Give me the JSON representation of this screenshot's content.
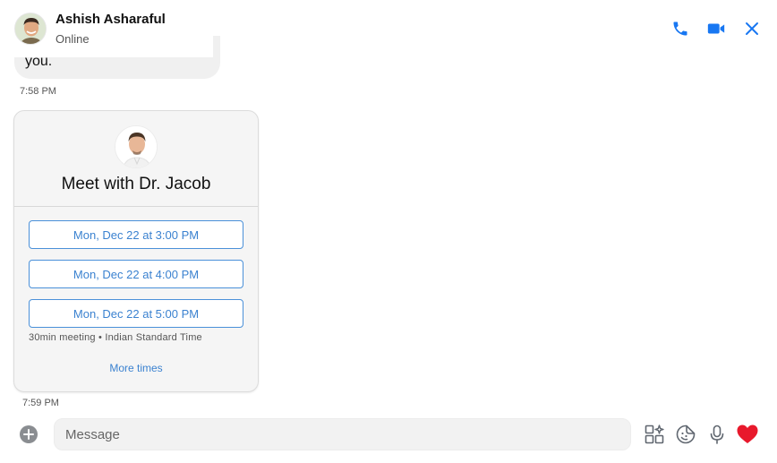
{
  "header": {
    "contact_name": "Ashish Asharaful",
    "status": "Online",
    "icons": {
      "call": "phone-icon",
      "video": "video-camera-icon",
      "close": "close-icon"
    },
    "accent_color": "#1877F2"
  },
  "messages": {
    "partial_text": "you.",
    "time_1": "7:58 PM",
    "time_2": "7:59 PM"
  },
  "booking_card": {
    "title": "Meet with Dr. Jacob",
    "slots": [
      "Mon, Dec 22 at 3:00 PM",
      "Mon, Dec 22 at 4:00 PM",
      "Mon, Dec 22 at 5:00 PM"
    ],
    "meeting_info": "30min meeting • Indian Standard Time",
    "more_times": "More times",
    "slot_color": "#3B82D0"
  },
  "composer": {
    "placeholder": "Message",
    "icons": {
      "add": "plus-circle-icon",
      "apps": "apps-icon",
      "sticker": "sticker-icon",
      "mic": "microphone-icon",
      "like": "heart-icon"
    },
    "like_color": "#E8192C"
  }
}
